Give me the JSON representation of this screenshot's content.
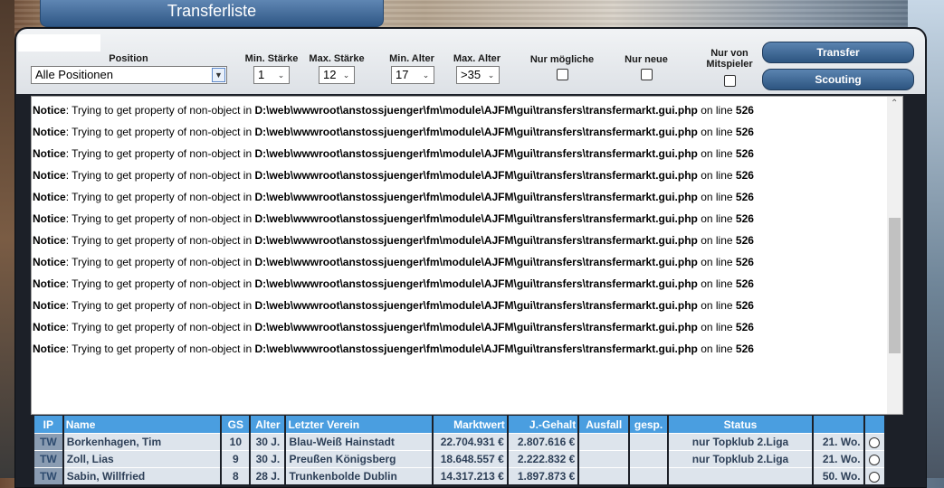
{
  "page_title": "Transferliste",
  "filters": {
    "position": {
      "label": "Position",
      "value": "Alle Positionen"
    },
    "min_staerke": {
      "label": "Min. Stärke",
      "value": "1"
    },
    "max_staerke": {
      "label": "Max. Stärke",
      "value": "12"
    },
    "min_alter": {
      "label": "Min. Alter",
      "value": "17"
    },
    "max_alter": {
      "label": "Max. Alter",
      "value": ">35"
    },
    "nur_moegliche": {
      "label": "Nur mögliche"
    },
    "nur_neue": {
      "label": "Nur neue"
    },
    "nur_von_mitspieler": {
      "label_line1": "Nur von",
      "label_line2": "Mitspieler"
    }
  },
  "buttons": {
    "transfer": "Transfer",
    "scouting": "Scouting"
  },
  "notice": {
    "prefix": "Notice",
    "message": ": Trying to get property of non-object in ",
    "path": "D:\\web\\wwwroot\\anstossjuenger\\fm\\module\\AJFM\\gui\\transfers\\transfermarkt.gui.php",
    "on_line": " on line ",
    "line": "526"
  },
  "notice_count": 12,
  "table": {
    "headers": [
      "IP",
      "Name",
      "GS",
      "Alter",
      "Letzter Verein",
      "Marktwert",
      "J.-Gehalt",
      "Ausfall",
      "gesp.",
      "Status",
      "",
      ""
    ],
    "rows": [
      {
        "ip": "TW",
        "name": "Borkenhagen, Tim",
        "gs": "10",
        "alter": "30 J.",
        "verein": "Blau-Weiß Hainstadt",
        "marktwert": "22.704.931 €",
        "gehalt": "2.807.616 €",
        "ausfall": "",
        "gesp": "",
        "status": "nur Topklub 2.Liga",
        "wochen": "21. Wo."
      },
      {
        "ip": "TW",
        "name": "Zoll, Lias",
        "gs": "9",
        "alter": "30 J.",
        "verein": "Preußen Königsberg",
        "marktwert": "18.648.557 €",
        "gehalt": "2.222.832 €",
        "ausfall": "",
        "gesp": "",
        "status": "nur Topklub 2.Liga",
        "wochen": "21. Wo."
      },
      {
        "ip": "TW",
        "name": "Sabin, Willfried",
        "gs": "8",
        "alter": "28 J.",
        "verein": "Trunkenbolde Dublin",
        "marktwert": "14.317.213 €",
        "gehalt": "1.897.873 €",
        "ausfall": "",
        "gesp": "",
        "status": "",
        "wochen": "50. Wo."
      }
    ]
  }
}
